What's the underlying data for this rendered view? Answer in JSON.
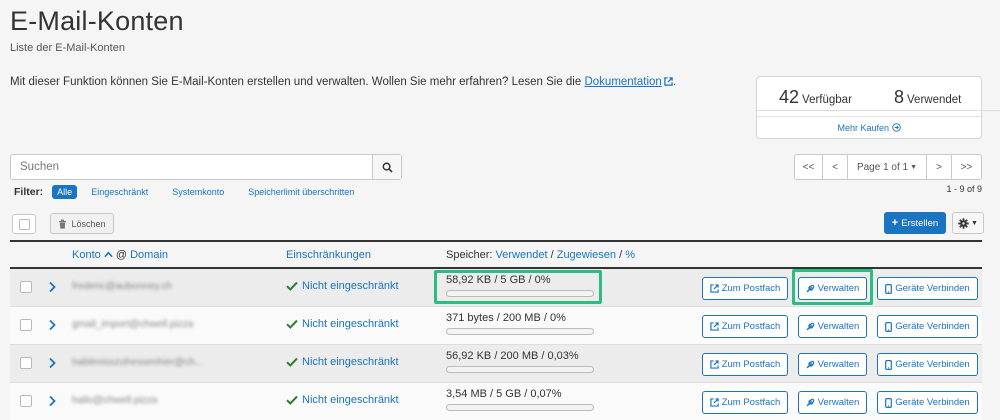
{
  "page": {
    "title": "E-Mail-Konten",
    "subtitle": "Liste der E-Mail-Konten",
    "intro_text": "Mit dieser Funktion können Sie E-Mail-Konten erstellen und verwalten. Wollen Sie mehr erfahren? Lesen Sie die ",
    "intro_link": "Dokumentation",
    "intro_end": "."
  },
  "stats": {
    "available_num": "42",
    "available_label": "Verfügbar",
    "used_num": "8",
    "used_label": "Verwendet",
    "buy_label": "Mehr Kaufen"
  },
  "search": {
    "placeholder": "Suchen"
  },
  "pagination": {
    "first": "<<",
    "prev": "<",
    "page_label": "Page 1 of 1",
    "next": ">",
    "last": ">>",
    "count": "1 - 9 of 9"
  },
  "filter": {
    "label": "Filter:",
    "options": [
      "Alle",
      "Eingeschränkt",
      "Systemkonto",
      "Speicherlimit überschritten"
    ]
  },
  "toolbar": {
    "delete_label": "Löschen",
    "create_label": "Erstellen"
  },
  "table": {
    "col_account": "Konto",
    "col_at": "@",
    "col_domain": "Domain",
    "col_restrictions": "Einschränkungen",
    "col_storage_prefix": "Speicher:",
    "col_storage_used": "Verwendet",
    "col_storage_sep1": "/",
    "col_storage_assigned": "Zugewiesen",
    "col_storage_sep2": "/",
    "col_storage_pct": "%",
    "btn_mailbox": "Zum Postfach",
    "btn_manage": "Verwalten",
    "btn_devices": "Geräte Verbinden",
    "rows": [
      {
        "account": "frederic@aubonney.ch",
        "restriction": "Nicht eingeschränkt",
        "usage": "58,92 KB / 5 GB / 0%",
        "usage_fraction": 0
      },
      {
        "account": "gmail_import@chwell.pizza",
        "restriction": "Nicht eingeschränkt",
        "usage": "371 bytes / 200 MB / 0%",
        "usage_fraction": 0
      },
      {
        "account": "habitmisszufressenhier@ch...",
        "restriction": "Nicht eingeschränkt",
        "usage": "56,92 KB / 200 MB / 0,03%",
        "usage_fraction": 0.0003
      },
      {
        "account": "hallo@chwell.pizza",
        "restriction": "Nicht eingeschränkt",
        "usage": "3,54 MB / 5 GB / 0,07%",
        "usage_fraction": 0.0007
      }
    ]
  },
  "colors": {
    "accent": "#1b74bf",
    "highlight": "#2dbd84",
    "check": "#2e7d32"
  }
}
